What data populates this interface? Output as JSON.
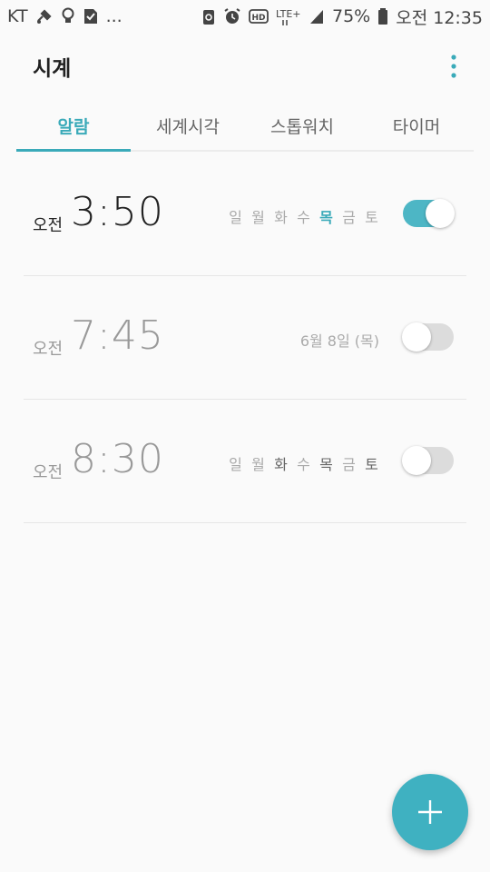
{
  "status_bar": {
    "carrier": "KT",
    "more": "...",
    "battery": "75%",
    "time": "오전 12:35"
  },
  "app": {
    "title": "시계"
  },
  "tabs": [
    {
      "label": "알람",
      "active": true
    },
    {
      "label": "세계시각",
      "active": false
    },
    {
      "label": "스톱워치",
      "active": false
    },
    {
      "label": "타이머",
      "active": false
    }
  ],
  "alarms": [
    {
      "ampm": "오전",
      "time": "3:50",
      "enabled": true,
      "days": [
        "일",
        "월",
        "화",
        "수",
        "목",
        "금",
        "토"
      ]
    },
    {
      "ampm": "오전",
      "time": "7:45",
      "enabled": false,
      "date": "6월 8일 (목)"
    },
    {
      "ampm": "오전",
      "time": "8:30",
      "enabled": false,
      "days": [
        "일",
        "월",
        "화",
        "수",
        "목",
        "금",
        "토"
      ]
    }
  ],
  "colors": {
    "accent": "#3aaab9",
    "fab": "#3fb1c1",
    "toggle_on": "#4db6c5"
  }
}
